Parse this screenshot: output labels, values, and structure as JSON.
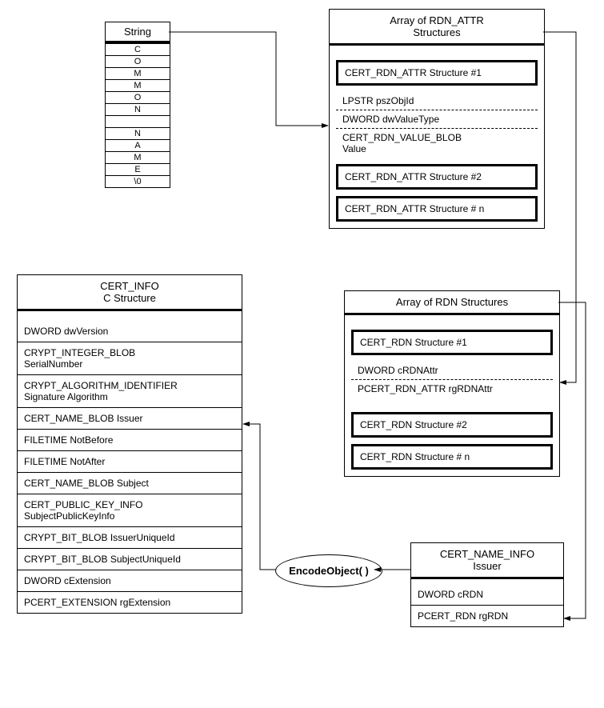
{
  "string": {
    "title": "String",
    "chars": [
      "C",
      "O",
      "M",
      "M",
      "O",
      "N",
      "",
      "N",
      "A",
      "M",
      "E",
      "\\0"
    ]
  },
  "rdnattr": {
    "title": "Array of RDN_ATTR\nStructures",
    "s1": "CERT_RDN_ATTR Structure #1",
    "f1": "LPSTR pszObjId",
    "f2": "DWORD dwValueType",
    "f3": "CERT_RDN_VALUE_BLOB\nValue",
    "s2": "CERT_RDN_ATTR Structure #2",
    "s3": "CERT_RDN_ATTR Structure # n"
  },
  "rdn": {
    "title": "Array of RDN  Structures",
    "s1": "CERT_RDN Structure #1",
    "f1": "DWORD  cRDNAttr",
    "f2": "PCERT_RDN_ATTR  rgRDNAttr",
    "s2": "CERT_RDN Structure #2",
    "s3": "CERT_RDN Structure # n"
  },
  "certinfo": {
    "title": "CERT_INFO\nC Structure",
    "r": [
      "DWORD dwVersion",
      "CRYPT_INTEGER_BLOB\nSerialNumber",
      "CRYPT_ALGORITHM_IDENTIFIER\nSignature Algorithm",
      "CERT_NAME_BLOB Issuer",
      "FILETIME NotBefore",
      "FILETIME NotAfter",
      "CERT_NAME_BLOB Subject",
      "CERT_PUBLIC_KEY_INFO\nSubjectPublicKeyInfo",
      "CRYPT_BIT_BLOB IssuerUniqueId",
      "CRYPT_BIT_BLOB SubjectUniqueId",
      "DWORD cExtension",
      "PCERT_EXTENSION rgExtension"
    ]
  },
  "nameinfo": {
    "title": "CERT_NAME_INFO\nIssuer",
    "r": [
      "DWORD  cRDN",
      "PCERT_RDN     rgRDN"
    ]
  },
  "encode": "EncodeObject( )"
}
